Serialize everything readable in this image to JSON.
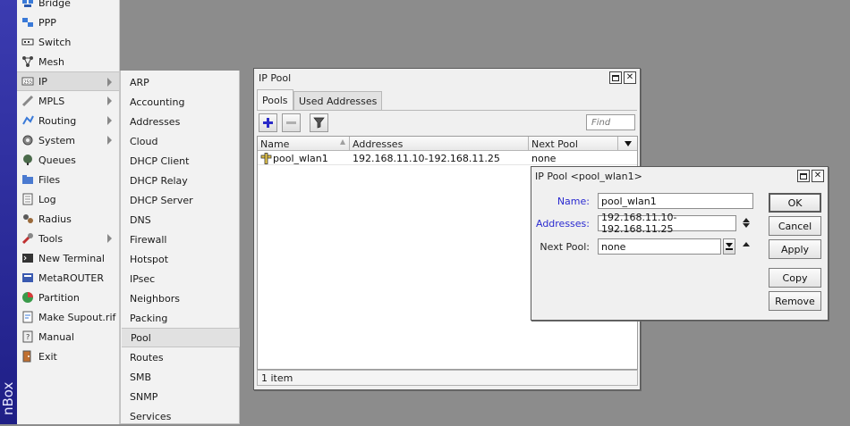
{
  "app": {
    "brand_text": "nBox",
    "accent_color": "#2a2a98"
  },
  "main_menu": {
    "items": [
      {
        "label": "Bridge",
        "icon": "bridge-icon"
      },
      {
        "label": "PPP",
        "icon": "ppp-icon"
      },
      {
        "label": "Switch",
        "icon": "switch-icon"
      },
      {
        "label": "Mesh",
        "icon": "mesh-icon"
      },
      {
        "label": "IP",
        "icon": "ip-icon",
        "has_submenu": true,
        "active": true
      },
      {
        "label": "MPLS",
        "icon": "mpls-icon",
        "has_submenu": true
      },
      {
        "label": "Routing",
        "icon": "routing-icon",
        "has_submenu": true
      },
      {
        "label": "System",
        "icon": "system-icon",
        "has_submenu": true
      },
      {
        "label": "Queues",
        "icon": "queues-icon"
      },
      {
        "label": "Files",
        "icon": "files-icon"
      },
      {
        "label": "Log",
        "icon": "log-icon"
      },
      {
        "label": "Radius",
        "icon": "radius-icon"
      },
      {
        "label": "Tools",
        "icon": "tools-icon",
        "has_submenu": true
      },
      {
        "label": "New Terminal",
        "icon": "terminal-icon"
      },
      {
        "label": "MetaROUTER",
        "icon": "metarouter-icon"
      },
      {
        "label": "Partition",
        "icon": "partition-icon"
      },
      {
        "label": "Make Supout.rif",
        "icon": "supout-icon"
      },
      {
        "label": "Manual",
        "icon": "manual-icon"
      },
      {
        "label": "Exit",
        "icon": "exit-icon"
      }
    ]
  },
  "ip_submenu": {
    "items": [
      "ARP",
      "Accounting",
      "Addresses",
      "Cloud",
      "DHCP Client",
      "DHCP Relay",
      "DHCP Server",
      "DNS",
      "Firewall",
      "Hotspot",
      "IPsec",
      "Neighbors",
      "Packing",
      "Pool",
      "Routes",
      "SMB",
      "SNMP",
      "Services"
    ],
    "active": "Pool"
  },
  "pool_window": {
    "title": "IP Pool",
    "tabs": [
      "Pools",
      "Used Addresses"
    ],
    "active_tab": "Pools",
    "find_placeholder": "Find",
    "columns": [
      "Name",
      "Addresses",
      "Next Pool"
    ],
    "rows": [
      {
        "name": "pool_wlan1",
        "addresses": "192.168.11.10-192.168.11.25",
        "next_pool": "none"
      }
    ],
    "status": "1 item"
  },
  "pool_dialog": {
    "title": "IP Pool <pool_wlan1>",
    "fields": {
      "name_label": "Name:",
      "name_value": "pool_wlan1",
      "addresses_label": "Addresses:",
      "addresses_value": "192.168.11.10-192.168.11.25",
      "next_pool_label": "Next Pool:",
      "next_pool_value": "none"
    },
    "buttons": {
      "ok": "OK",
      "cancel": "Cancel",
      "apply": "Apply",
      "copy": "Copy",
      "remove": "Remove"
    },
    "label_color": "#2a2ad0"
  }
}
